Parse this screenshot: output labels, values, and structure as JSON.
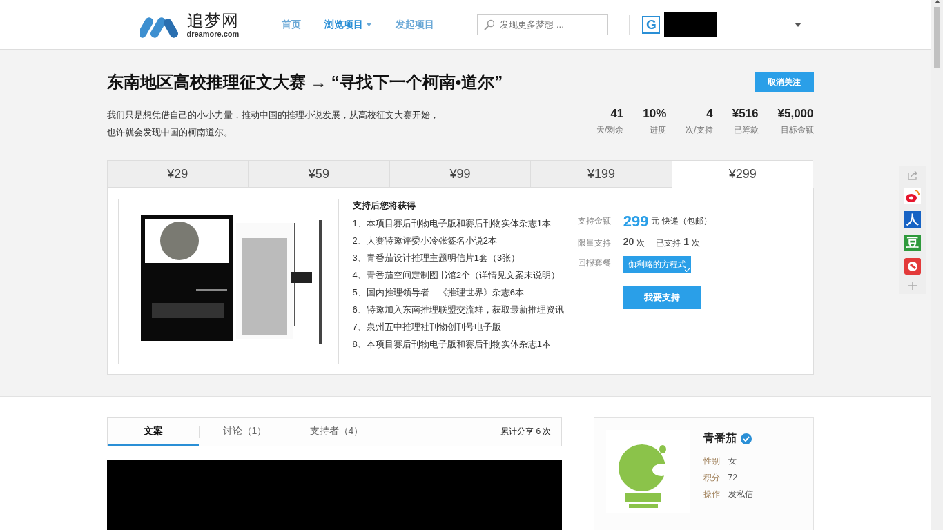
{
  "header": {
    "logo": {
      "name": "追梦网",
      "domain": "dreamore.com"
    },
    "nav": [
      {
        "label": "首页",
        "selected": false,
        "menu": false
      },
      {
        "label": "浏览项目",
        "selected": true,
        "menu": true
      },
      {
        "label": "发起项目",
        "selected": false,
        "menu": false
      }
    ],
    "search": {
      "placeholder": "发现更多梦想 ..."
    },
    "user": {
      "avatar": "G"
    }
  },
  "project": {
    "title": "东南地区高校推理征文大赛 → “寻找下一个柯南•道尔”",
    "follow_button": "取消关注",
    "description": "我们只是想凭借自己的小小力量，推动中国的推理小说发展，从高校征文大赛开始，也许就会发现中国的柯南道尔。",
    "stats": [
      {
        "value": "41",
        "label": "天/剩余"
      },
      {
        "value": "10%",
        "label": "进度"
      },
      {
        "value": "4",
        "label": "次/支持"
      },
      {
        "value": "¥516",
        "label": "已筹款"
      },
      {
        "value": "¥5,000",
        "label": "目标金额"
      }
    ]
  },
  "reward_tabs": [
    {
      "label": "¥29",
      "selected": false
    },
    {
      "label": "¥59",
      "selected": false
    },
    {
      "label": "¥99",
      "selected": false
    },
    {
      "label": "¥199",
      "selected": false
    },
    {
      "label": "¥299",
      "selected": true
    }
  ],
  "reward": {
    "heading": "支持后您将获得",
    "items": [
      "1、本项目赛后刊物电子版和赛后刊物实体杂志1本",
      "2、大赛特邀评委小冷张签名小说2本",
      "3、青番茄设计推理主题明信片1套（3张）",
      "4、青番茄空间定制图书馆2个（详情见文案末说明）",
      "5、国内推理领导者—《推理世界》杂志6本",
      "6、特邀加入东南推理联盟交流群，获取最新推理资讯",
      "7、泉州五中推理社刊物创刊号电子版",
      "8、本项目赛后刊物电子版和赛后刊物实体杂志1本"
    ],
    "amount_label": "支持金额",
    "amount": "299",
    "amount_note": "元 快递（包邮）",
    "limit_label": "限量支持",
    "limit": "20",
    "limit_unit": "次",
    "supported_prefix": "已支持",
    "supported": "1",
    "supported_unit": "次",
    "package_label": "回报套餐",
    "package": "伽利略的方程式",
    "support_button": "我要支持"
  },
  "content_tabs": [
    {
      "label": "文案",
      "selected": true
    },
    {
      "label": "讨论（1）",
      "selected": false
    },
    {
      "label": "支持者（4）",
      "selected": false
    }
  ],
  "share_count": "累计分享 6 次",
  "creator": {
    "name": "青番茄",
    "verified": true,
    "fields": [
      {
        "label": "性别",
        "value": "女"
      },
      {
        "label": "积分",
        "value": "72"
      },
      {
        "label": "操作",
        "value": "发私信"
      }
    ]
  },
  "share_bar": [
    {
      "kind": "share"
    },
    {
      "kind": "weibo",
      "color": "#e6162d"
    },
    {
      "kind": "glyph",
      "label": "人",
      "color": "#1763c4"
    },
    {
      "kind": "glyph",
      "label": "豆",
      "color": "#2f9a3c"
    },
    {
      "kind": "round",
      "color": "#e33a3a"
    },
    {
      "kind": "plus"
    }
  ]
}
